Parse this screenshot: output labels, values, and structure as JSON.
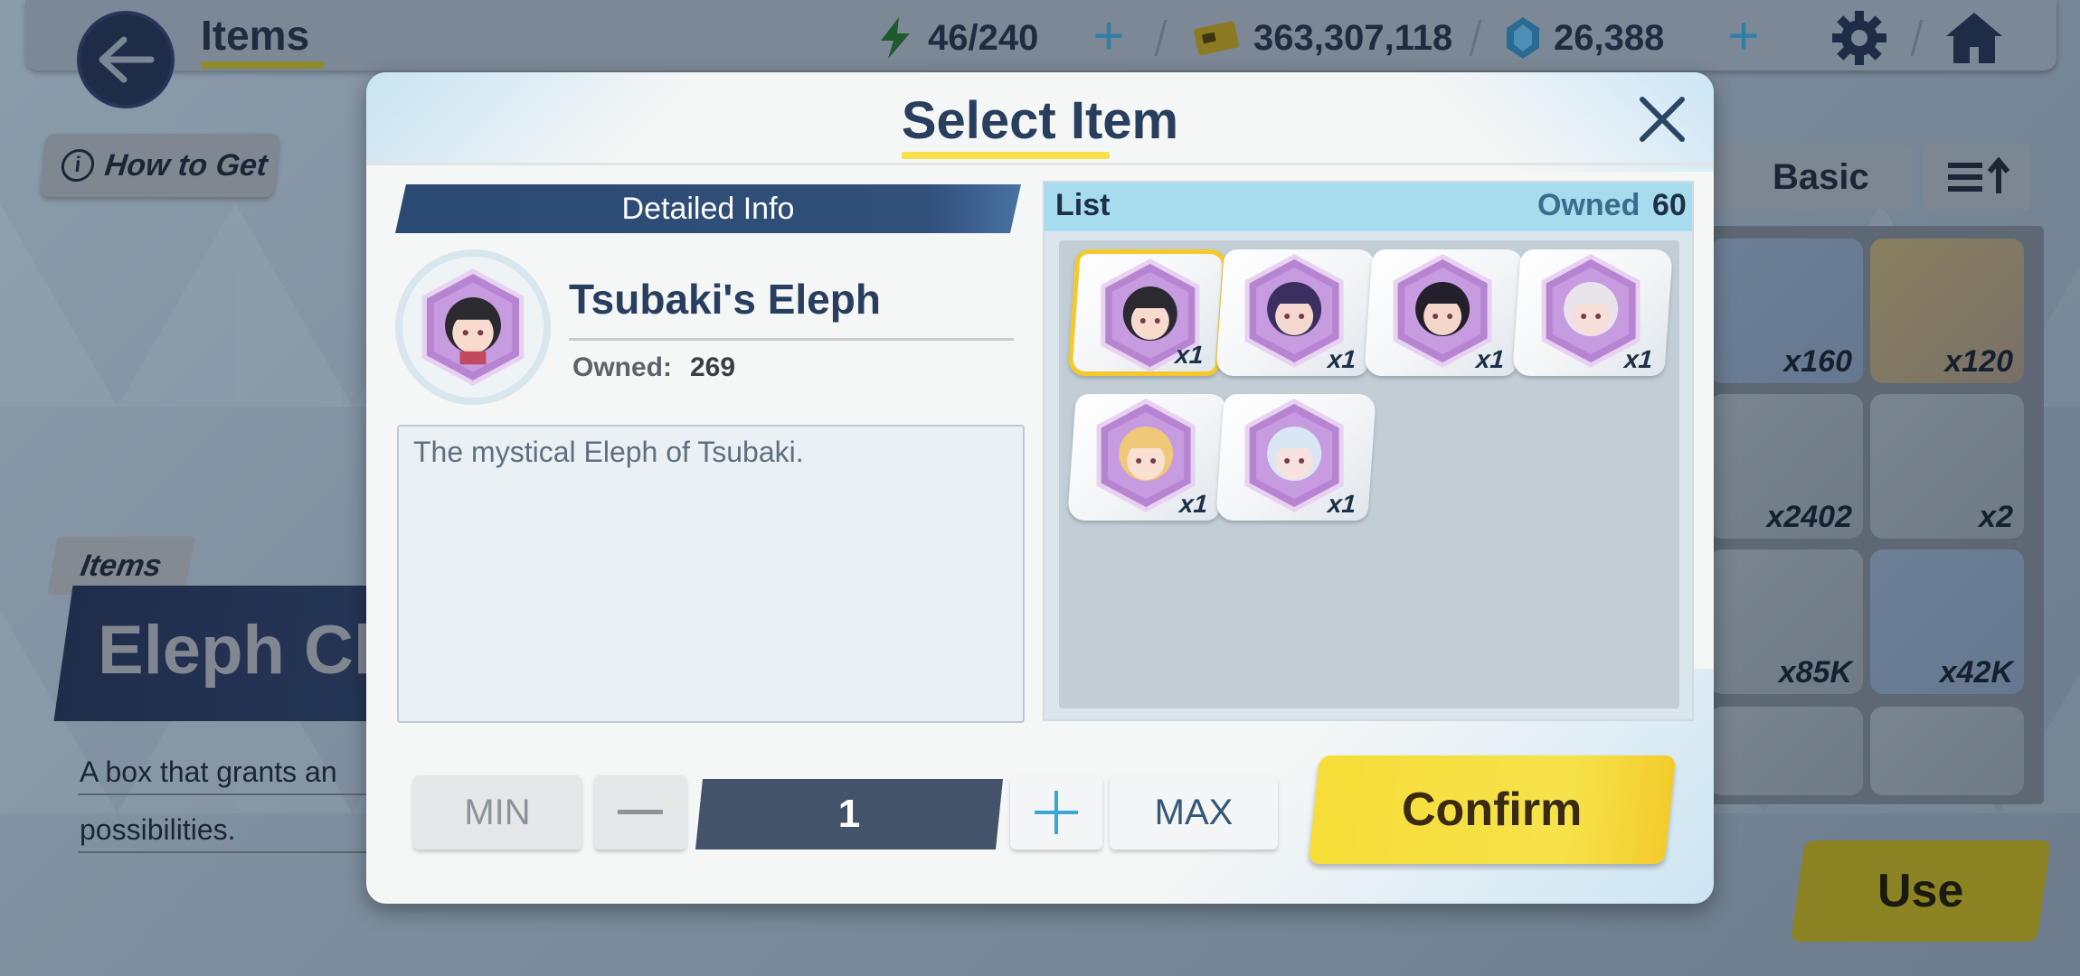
{
  "background": {
    "title": "Items",
    "resources": {
      "stamina": "46/240",
      "credits": "363,307,118",
      "gems": "26,388"
    },
    "how_to_get": "How to Get",
    "items_tag": "Items",
    "banner_title": "Eleph Ch",
    "description_lines": [
      "A box that grants an",
      "possibilities."
    ],
    "filter_label": "Basic",
    "inventory_counts": [
      "x160",
      "x120",
      "x2402",
      "x2",
      "x85K",
      "x42K"
    ],
    "use_label": "Use"
  },
  "dialog": {
    "title": "Select Item",
    "detail_header": "Detailed Info",
    "item_name": "Tsubaki's Eleph",
    "owned_label": "Owned:",
    "owned_value": "269",
    "description": "The mystical Eleph of Tsubaki.",
    "list": {
      "title": "List",
      "owned_label": "Owned",
      "owned_value": "60",
      "items": [
        {
          "count": "x1",
          "selected": true,
          "hair": "#2a2a30",
          "skin": "#f7dccd"
        },
        {
          "count": "x1",
          "selected": false,
          "hair": "#3a2f5e",
          "skin": "#f4d7cf"
        },
        {
          "count": "x1",
          "selected": false,
          "hair": "#23202b",
          "skin": "#f5d6cb"
        },
        {
          "count": "x1",
          "selected": false,
          "hair": "#e9e3ec",
          "skin": "#f6dfd8"
        },
        {
          "count": "x1",
          "selected": false,
          "hair": "#f0c87a",
          "skin": "#f8e0d2"
        },
        {
          "count": "x1",
          "selected": false,
          "hair": "#d9e6f4",
          "skin": "#f6e2df"
        }
      ]
    },
    "controls": {
      "min_label": "MIN",
      "quantity": "1",
      "max_label": "MAX",
      "confirm_label": "Confirm"
    }
  },
  "colors": {
    "accent_yellow": "#f6dd37",
    "title_navy": "#273e5e",
    "list_header": "#a7dcef",
    "selected_border": "#f6c92b"
  }
}
